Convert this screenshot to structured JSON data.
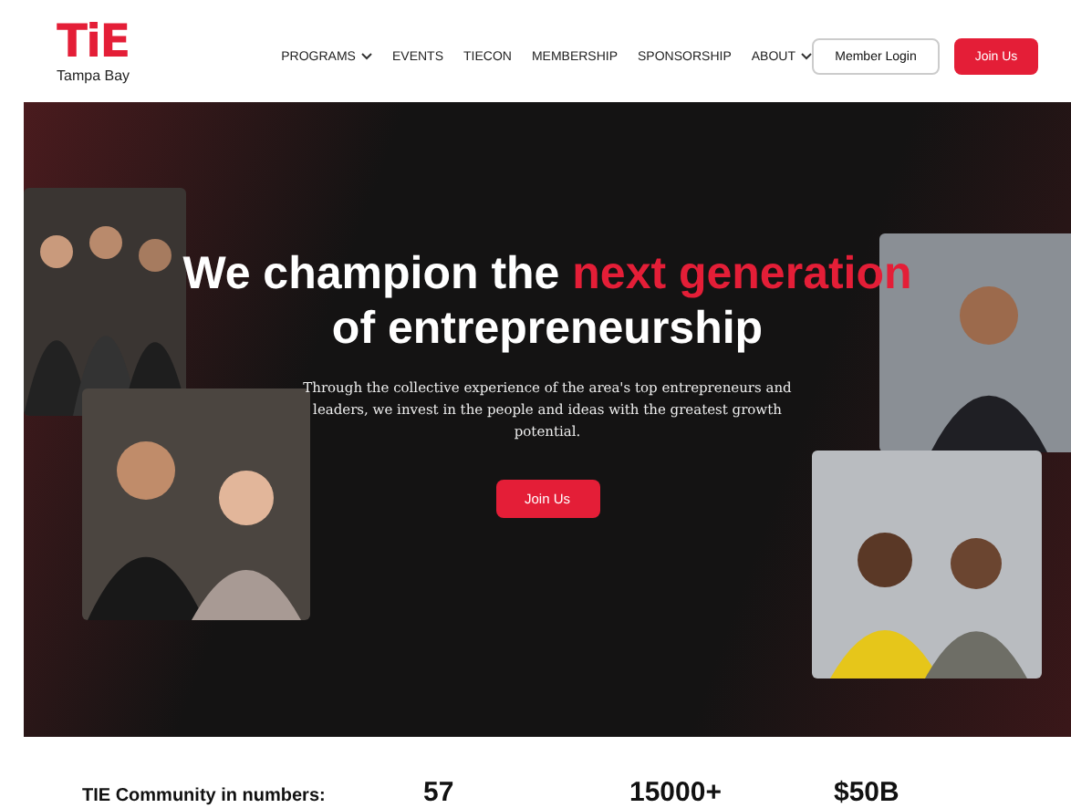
{
  "logo": {
    "mark": "TiE",
    "subtitle": "Tampa Bay"
  },
  "nav": [
    {
      "label": "PROGRAMS",
      "dropdown": true
    },
    {
      "label": "EVENTS",
      "dropdown": false
    },
    {
      "label": "TIECON",
      "dropdown": false
    },
    {
      "label": "MEMBERSHIP",
      "dropdown": false
    },
    {
      "label": "SPONSORSHIP",
      "dropdown": false
    },
    {
      "label": "ABOUT",
      "dropdown": true
    }
  ],
  "header_buttons": [
    {
      "label": "Member Login",
      "kind": "outline"
    },
    {
      "label": "Join Us",
      "kind": "primary"
    }
  ],
  "hero": {
    "heading_start": "We champion the",
    "heading_highlight": "next generation",
    "heading_end": "of entrepreneurship",
    "text": "Through the collective experience of the area's top entrepreneurs and leaders, we invest in the people and ideas with the greatest growth potential.",
    "button": "Join Us"
  },
  "stats": {
    "title": "TIE Community in numbers:",
    "values": [
      "57",
      "15000+",
      "$50B"
    ]
  }
}
